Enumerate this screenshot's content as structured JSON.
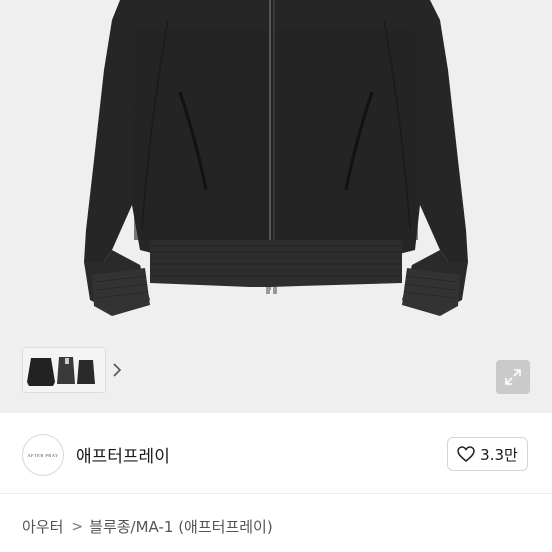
{
  "product": {
    "image_alt": "black bomber jacket",
    "thumbnails": [
      {
        "name": "jacket-front-and-back"
      }
    ],
    "thumb_next_icon": "chevron-right-icon",
    "expand_icon": "expand-arrows-icon"
  },
  "seller": {
    "avatar_text": "AFTER PRAY",
    "name": "애프터프레이"
  },
  "like": {
    "icon": "heart-outline-icon",
    "count": "3.3만"
  },
  "breadcrumb": {
    "items": [
      "아우터",
      "블루종/MA-1 (애프터프레이)"
    ],
    "separator": ">"
  }
}
